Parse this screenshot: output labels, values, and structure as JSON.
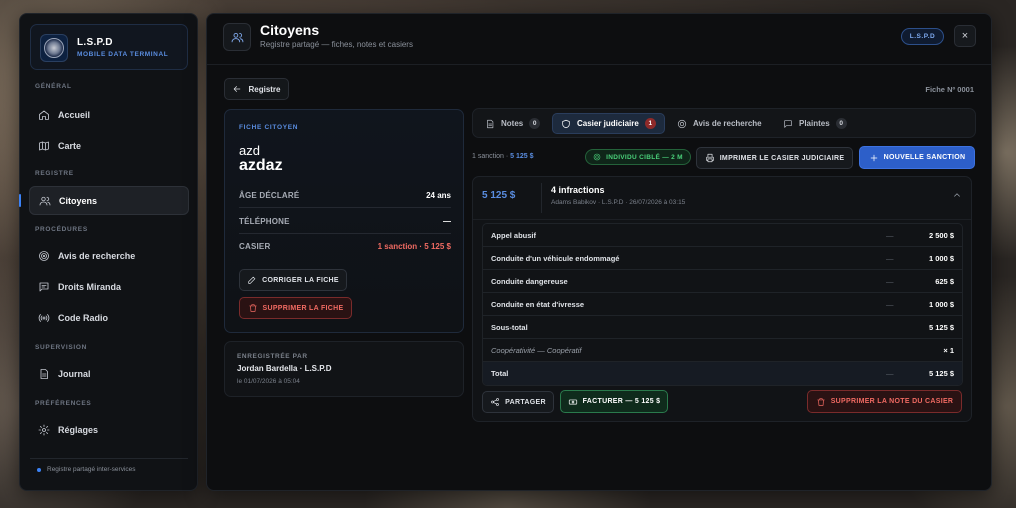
{
  "brand": {
    "name": "L.S.P.D",
    "subtitle": "MOBILE DATA TERMINAL"
  },
  "sidebar": {
    "sections": [
      {
        "label": "GÉNÉRAL"
      },
      {
        "label": "REGISTRE"
      },
      {
        "label": "PROCÉDURES"
      },
      {
        "label": "SUPERVISION"
      },
      {
        "label": "PRÉFÉRENCES"
      }
    ],
    "items": [
      {
        "label": "Accueil",
        "icon": "home-icon"
      },
      {
        "label": "Carte",
        "icon": "map-icon"
      },
      {
        "label": "Citoyens",
        "icon": "users-icon",
        "active": true
      },
      {
        "label": "Avis de recherche",
        "icon": "target-icon"
      },
      {
        "label": "Droits Miranda",
        "icon": "message-icon"
      },
      {
        "label": "Code Radio",
        "icon": "radio-icon"
      },
      {
        "label": "Journal",
        "icon": "document-icon"
      },
      {
        "label": "Réglages",
        "icon": "gear-icon"
      }
    ],
    "footer": "Registre partagé inter-services"
  },
  "header": {
    "title": "Citoyens",
    "subtitle": "Registre partagé — fiches, notes et casiers",
    "badge": "L.S.P.D",
    "close": "×"
  },
  "back_label": "Registre",
  "fiche_number": "Fiche Nº 0001",
  "citizen": {
    "section": "FICHE CITOYEN",
    "first_name": "azd",
    "last_name": "azdaz",
    "fields": [
      {
        "key": "ÂGE DÉCLARÉ",
        "value": "24 ans"
      },
      {
        "key": "TÉLÉPHONE",
        "value": "—"
      },
      {
        "key": "CASIER",
        "value": "1 sanction · 5 125 $"
      }
    ],
    "edit_label": "CORRIGER LA FICHE",
    "delete_label": "SUPPRIMER LA FICHE"
  },
  "registered": {
    "label": "ENREGISTRÉE PAR",
    "name": "Jordan Bardella · L.S.P.D",
    "date": "le 01/07/2026 à 05:04"
  },
  "tabs": [
    {
      "label": "Notes",
      "count": "0",
      "icon": "note-icon"
    },
    {
      "label": "Casier judiciaire",
      "count": "1",
      "icon": "shield-icon",
      "active": true
    },
    {
      "label": "Avis de recherche",
      "icon": "target-icon"
    },
    {
      "label": "Plaintes",
      "count": "0",
      "icon": "message-icon"
    }
  ],
  "actions": {
    "summary_prefix": "1 sanction · ",
    "summary_amount": "5 125 $",
    "target_pill": "INDIVIDU CIBLÉ — 2 M",
    "print_label": "IMPRIMER LE CASIER JUDICIAIRE",
    "new_label": "NOUVELLE SANCTION"
  },
  "sanction": {
    "amount": "5 125 $",
    "title": "4 infractions",
    "meta": "Adams Babikov · L.S.P.D · 26/07/2026 à 03:15",
    "rows": [
      {
        "label": "Appel abusif",
        "dash": "—",
        "amount": "2 500 $"
      },
      {
        "label": "Conduite d'un véhicule endommagé",
        "dash": "—",
        "amount": "1 000 $"
      },
      {
        "label": "Conduite dangereuse",
        "dash": "—",
        "amount": "625 $"
      },
      {
        "label": "Conduite en état d'ivresse",
        "dash": "—",
        "amount": "1 000 $"
      },
      {
        "label": "Sous-total",
        "dash": "",
        "amount": "5 125 $"
      },
      {
        "label": "Coopérativité — Coopératif",
        "dash": "",
        "amount": "× 1"
      },
      {
        "label": "Total",
        "dash": "—",
        "amount": "5 125 $"
      }
    ],
    "share_label": "PARTAGER",
    "bill_label": "FACTURER — 5 125 $",
    "delete_note_label": "SUPPRIMER LA NOTE DU CASIER"
  },
  "colors": {
    "accent": "#3b82f6",
    "danger": "#f06a62",
    "success": "#4ad07a"
  }
}
